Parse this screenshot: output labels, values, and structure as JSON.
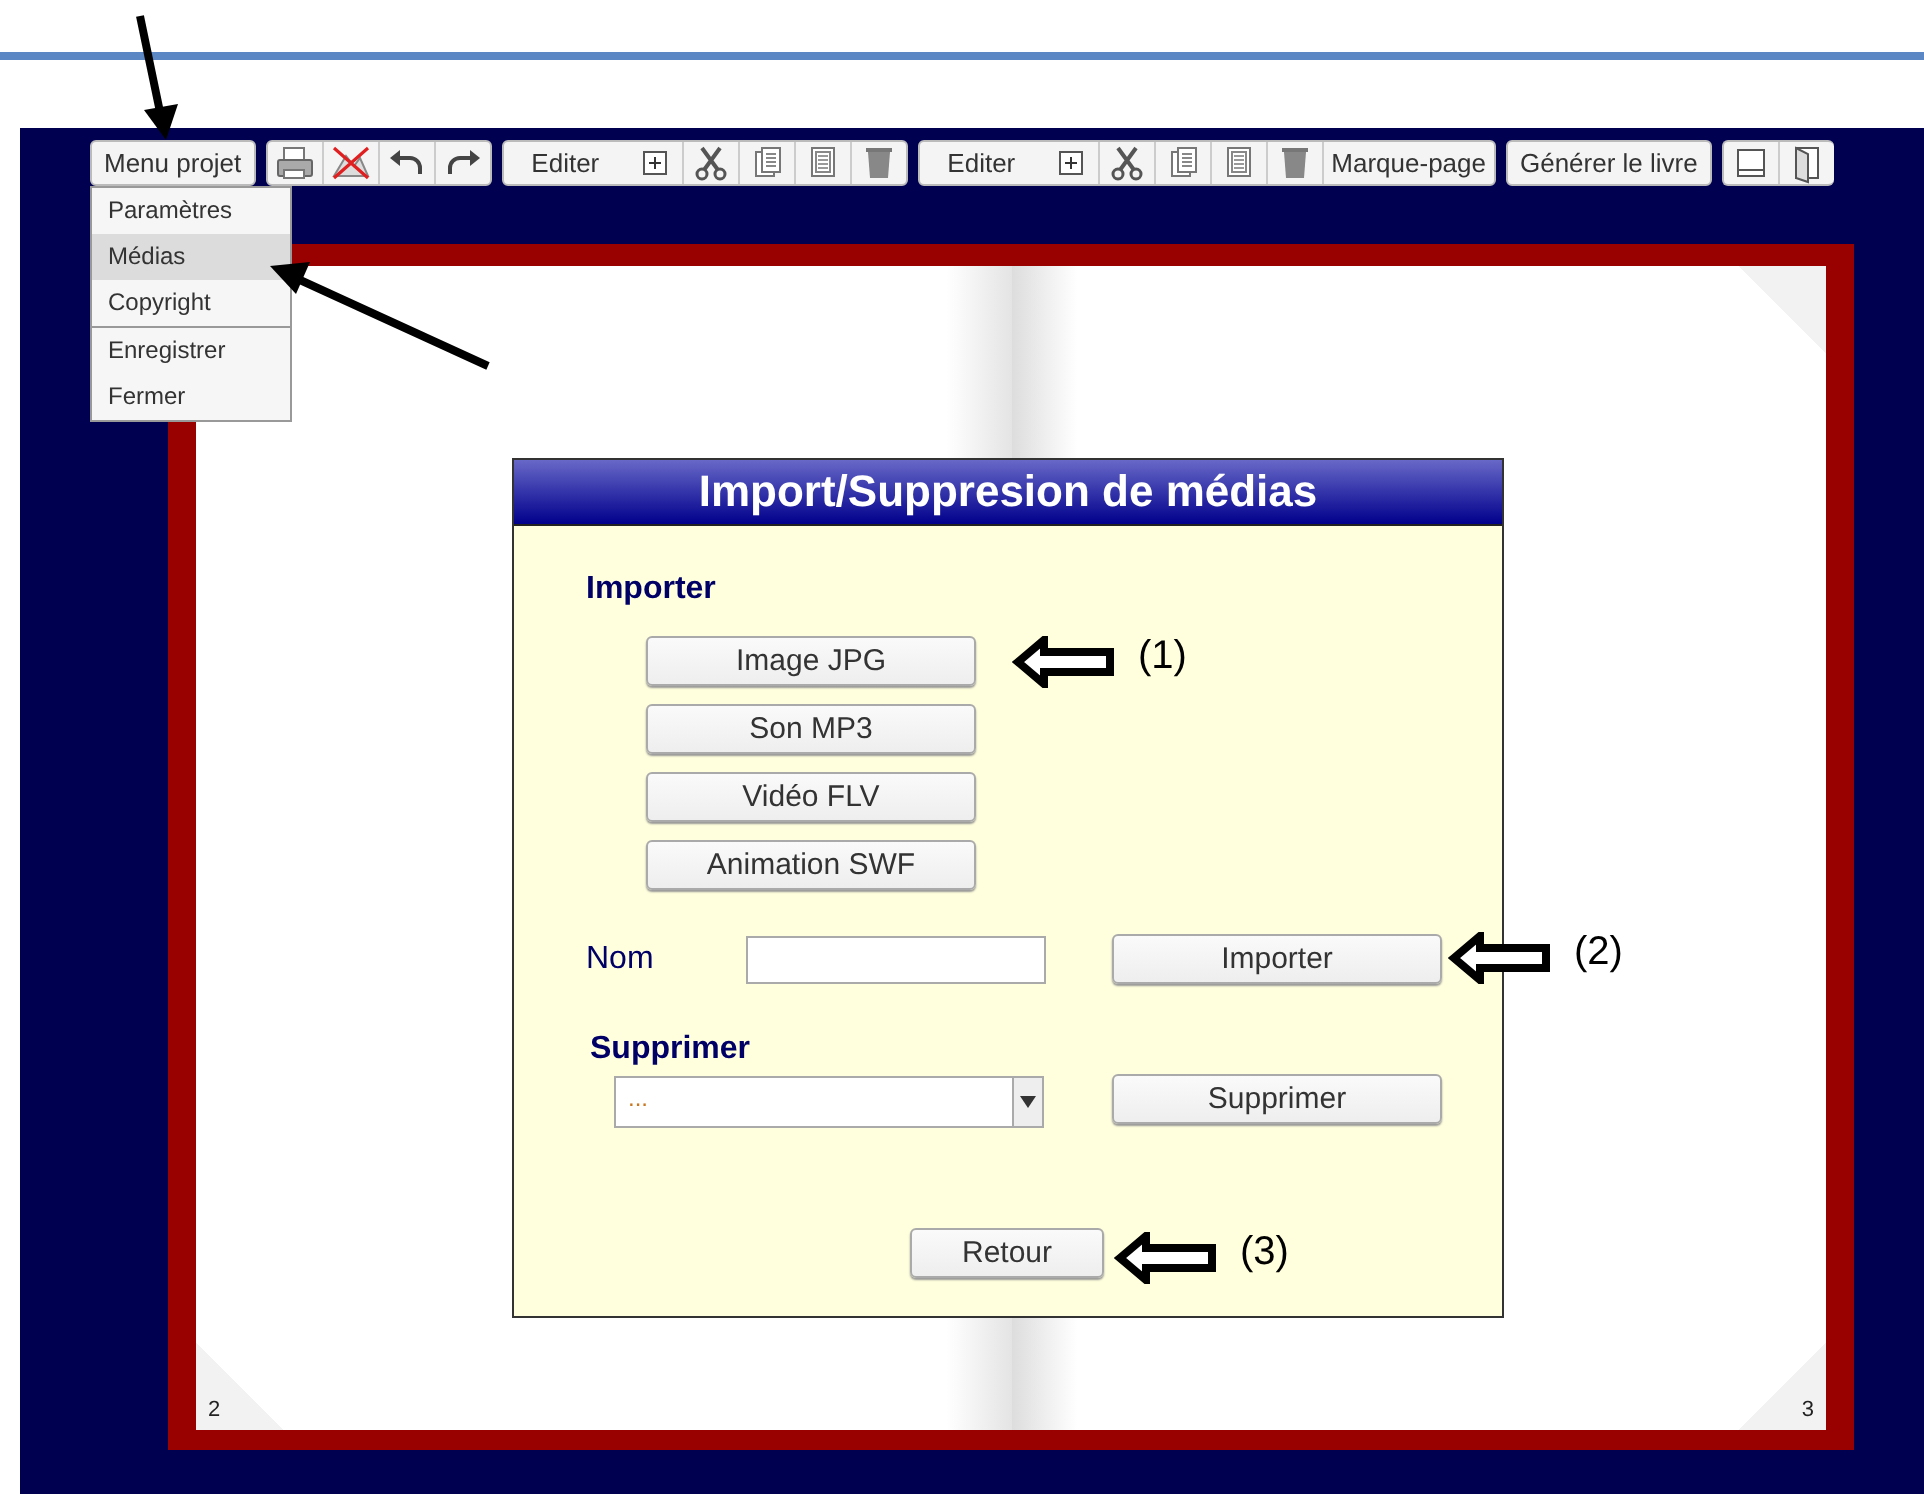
{
  "toolbar": {
    "menu_button": "Menu projet",
    "edit_buttons": [
      "Editer",
      "Editer"
    ],
    "bookmark_button": "Marque-page",
    "generate_button": "Générer le livre"
  },
  "project_menu": {
    "items": [
      {
        "label": "Paramètres",
        "selected": false,
        "separator_before": false
      },
      {
        "label": "Médias",
        "selected": true,
        "separator_before": false
      },
      {
        "label": "Copyright",
        "selected": false,
        "separator_before": false
      },
      {
        "label": "Enregistrer",
        "selected": false,
        "separator_before": true
      },
      {
        "label": "Fermer",
        "selected": false,
        "separator_before": false
      }
    ]
  },
  "book": {
    "left_page_number": "2",
    "right_page_number": "3"
  },
  "dialog": {
    "title": "Import/Suppresion de médias",
    "import_heading": "Importer",
    "media_buttons": [
      "Image JPG",
      "Son MP3",
      "Vidéo FLV",
      "Animation SWF"
    ],
    "name_label": "Nom",
    "import_button": "Importer",
    "delete_heading": "Supprimer",
    "media_select": "...",
    "delete_button": "Supprimer",
    "back_button": "Retour"
  },
  "annotations": [
    {
      "label": "(1)"
    },
    {
      "label": "(2)"
    },
    {
      "label": "(3)"
    }
  ]
}
